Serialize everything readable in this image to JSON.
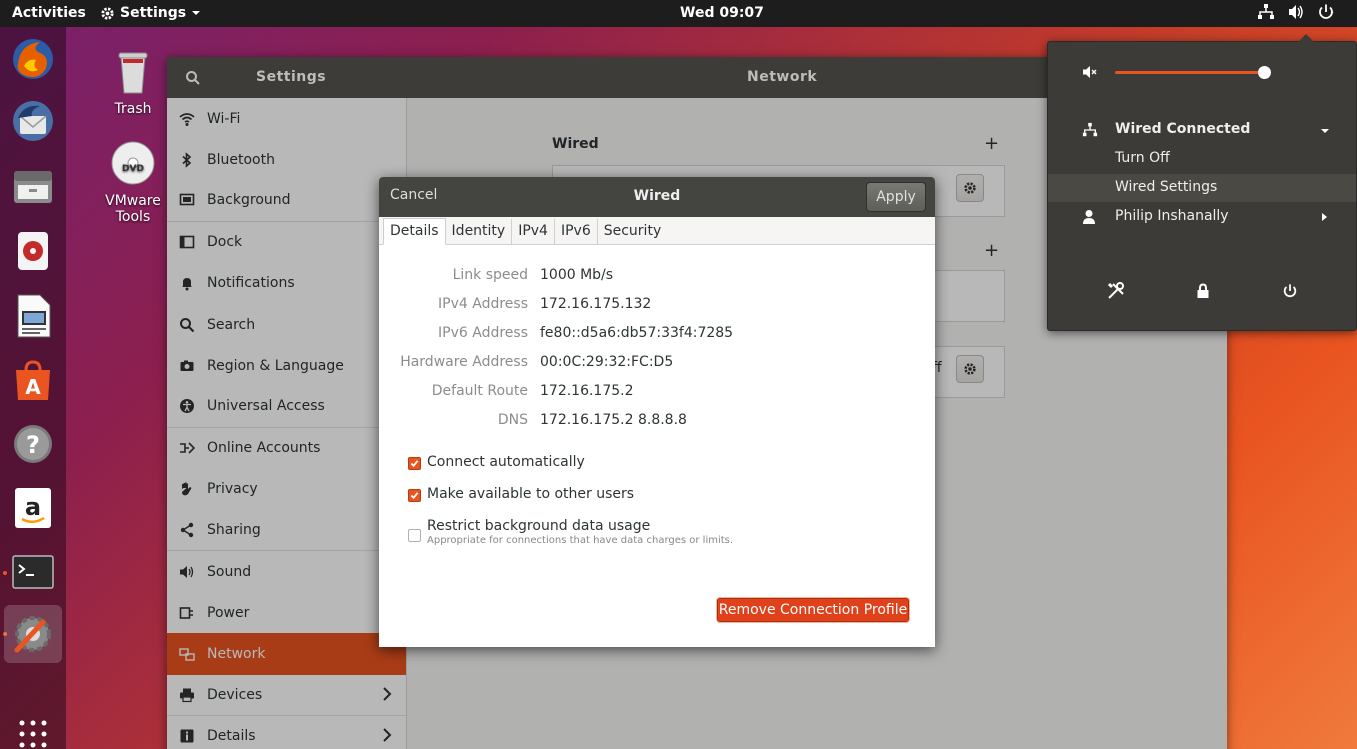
{
  "topbar": {
    "activities": "Activities",
    "app_menu": "Settings",
    "clock": "Wed 09:07"
  },
  "desktop": {
    "trash_label": "Trash",
    "vmware_label": "VMware Tools",
    "dvd_text": "DVD"
  },
  "settings": {
    "header_left": "Settings",
    "header_title": "Network",
    "sidebar": [
      {
        "label": "Wi-Fi",
        "icon": "wifi-icon"
      },
      {
        "label": "Bluetooth",
        "icon": "bluetooth-icon"
      },
      {
        "label": "Background",
        "icon": "background-icon"
      },
      {
        "label": "Dock",
        "icon": "dock-icon"
      },
      {
        "label": "Notifications",
        "icon": "bell-icon"
      },
      {
        "label": "Search",
        "icon": "search-icon"
      },
      {
        "label": "Region & Language",
        "icon": "camera-icon"
      },
      {
        "label": "Universal Access",
        "icon": "accessibility-icon"
      },
      {
        "label": "Online Accounts",
        "icon": "online-accounts-icon"
      },
      {
        "label": "Privacy",
        "icon": "hand-icon"
      },
      {
        "label": "Sharing",
        "icon": "share-icon"
      },
      {
        "label": "Sound",
        "icon": "speaker-icon"
      },
      {
        "label": "Power",
        "icon": "power-plug-icon"
      },
      {
        "label": "Network",
        "icon": "network-icon"
      },
      {
        "label": "Devices",
        "icon": "printer-icon"
      },
      {
        "label": "Details",
        "icon": "info-icon"
      }
    ],
    "panel": {
      "wired_title": "Wired",
      "off_text": "ff"
    }
  },
  "dialog": {
    "cancel": "Cancel",
    "title": "Wired",
    "apply": "Apply",
    "tabs": [
      "Details",
      "Identity",
      "IPv4",
      "IPv6",
      "Security"
    ],
    "details": [
      {
        "label": "Link speed",
        "value": "1000 Mb/s"
      },
      {
        "label": "IPv4 Address",
        "value": "172.16.175.132"
      },
      {
        "label": "IPv6 Address",
        "value": "fe80::d5a6:db57:33f4:7285"
      },
      {
        "label": "Hardware Address",
        "value": "00:0C:29:32:FC:D5"
      },
      {
        "label": "Default Route",
        "value": "172.16.175.2"
      },
      {
        "label": "DNS",
        "value": "172.16.175.2 8.8.8.8"
      }
    ],
    "connect_auto": "Connect automatically",
    "make_available": "Make available to other users",
    "restrict": "Restrict background data usage",
    "restrict_sub": "Appropriate for connections that have data charges or limits.",
    "remove_btn": "Remove Connection Profile"
  },
  "sys_menu": {
    "wired_connected": "Wired Connected",
    "turn_off": "Turn Off",
    "wired_settings": "Wired Settings",
    "user": "Philip Inshanally"
  },
  "colors": {
    "accent": "#e95420",
    "topbar": "#1d1d1d",
    "menu_bg": "#3c3b37"
  }
}
